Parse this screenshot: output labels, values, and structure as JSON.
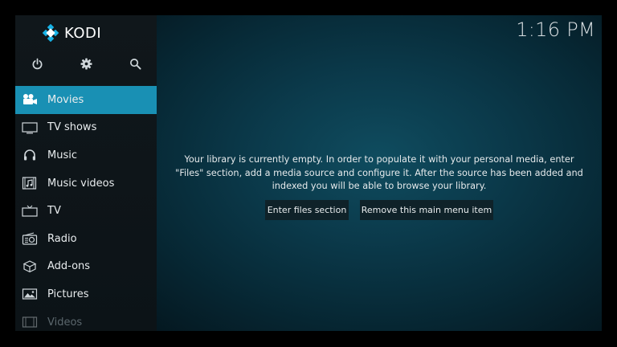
{
  "app": {
    "name": "KODI",
    "clock": "1:16 PM",
    "accent_color": "#1990b4"
  },
  "top_icons": [
    {
      "name": "power-icon"
    },
    {
      "name": "settings-gear-icon"
    },
    {
      "name": "search-icon"
    }
  ],
  "menu": {
    "items": [
      {
        "label": "Movies",
        "icon": "movie-camera-icon",
        "active": true
      },
      {
        "label": "TV shows",
        "icon": "tv-shows-icon"
      },
      {
        "label": "Music",
        "icon": "headphones-icon"
      },
      {
        "label": "Music videos",
        "icon": "music-video-icon"
      },
      {
        "label": "TV",
        "icon": "tv-icon"
      },
      {
        "label": "Radio",
        "icon": "radio-icon"
      },
      {
        "label": "Add-ons",
        "icon": "addons-box-icon"
      },
      {
        "label": "Pictures",
        "icon": "picture-icon"
      },
      {
        "label": "Videos",
        "icon": "film-icon"
      }
    ]
  },
  "main": {
    "message_line1": "Your library is currently empty. In order to populate it with your personal media, enter",
    "message_line2": "\"Files\" section, add a media source and configure it. After the source has been added and",
    "message_line3": "indexed you will be able to browse your library.",
    "enter_files_label": "Enter files section",
    "remove_item_label": "Remove this main menu item"
  }
}
